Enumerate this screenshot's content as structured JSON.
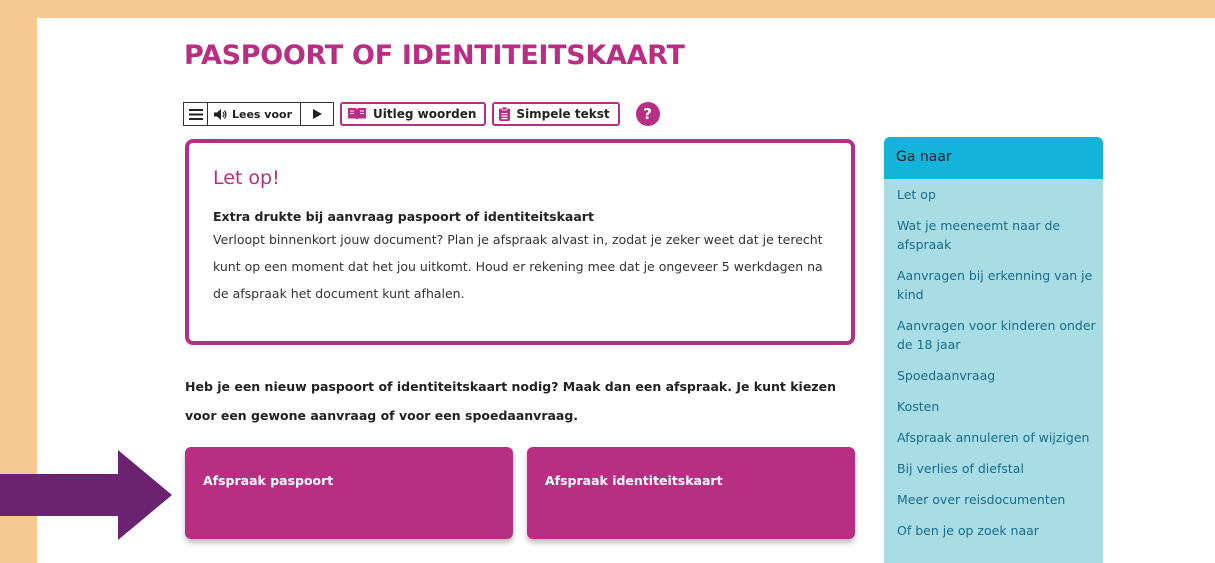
{
  "page": {
    "title": "PASPOORT OF IDENTITEITSKAART"
  },
  "toolbar": {
    "menu_icon": "hamburger-icon",
    "read_label": "Lees voor",
    "play_icon": "play-icon",
    "explain_label": "Uitleg woorden",
    "simple_label": "Simpele tekst",
    "help_label": "?"
  },
  "notice": {
    "title": "Let op!",
    "heading": "Extra drukte bij aanvraag paspoort of identiteitskaart",
    "body": "Verloopt binnenkort jouw document? Plan je afspraak alvast in, zodat je zeker weet dat je terecht kunt op een moment dat het jou uitkomt. Houd er rekening mee dat je ongeveer 5 werkdagen na de afspraak het document kunt afhalen."
  },
  "intro": "Heb je een nieuw paspoort of identiteitskaart nodig? Maak dan een afspraak. Je kunt kiezen voor een gewone aanvraag of voor een spoedaanvraag.",
  "cards": {
    "passport": "Afspraak paspoort",
    "id_card": "Afspraak identiteitskaart"
  },
  "aside": {
    "title": "Ga naar",
    "items": [
      "Let op",
      "Wat je meeneemt naar de afspraak",
      "Aanvragen bij erkenning van je kind",
      "Aanvragen voor kinderen onder de 18 jaar",
      "Spoedaanvraag",
      "Kosten",
      "Afspraak annuleren of wijzigen",
      "Bij verlies of diefstal",
      "Meer over reisdocumenten",
      "Of ben je op zoek naar"
    ]
  },
  "colors": {
    "brand": "#b72e82",
    "background_frame": "#f7c992",
    "aside_header": "#14b3da",
    "aside_bg": "#a8dde6",
    "arrow": "#6b2270"
  }
}
